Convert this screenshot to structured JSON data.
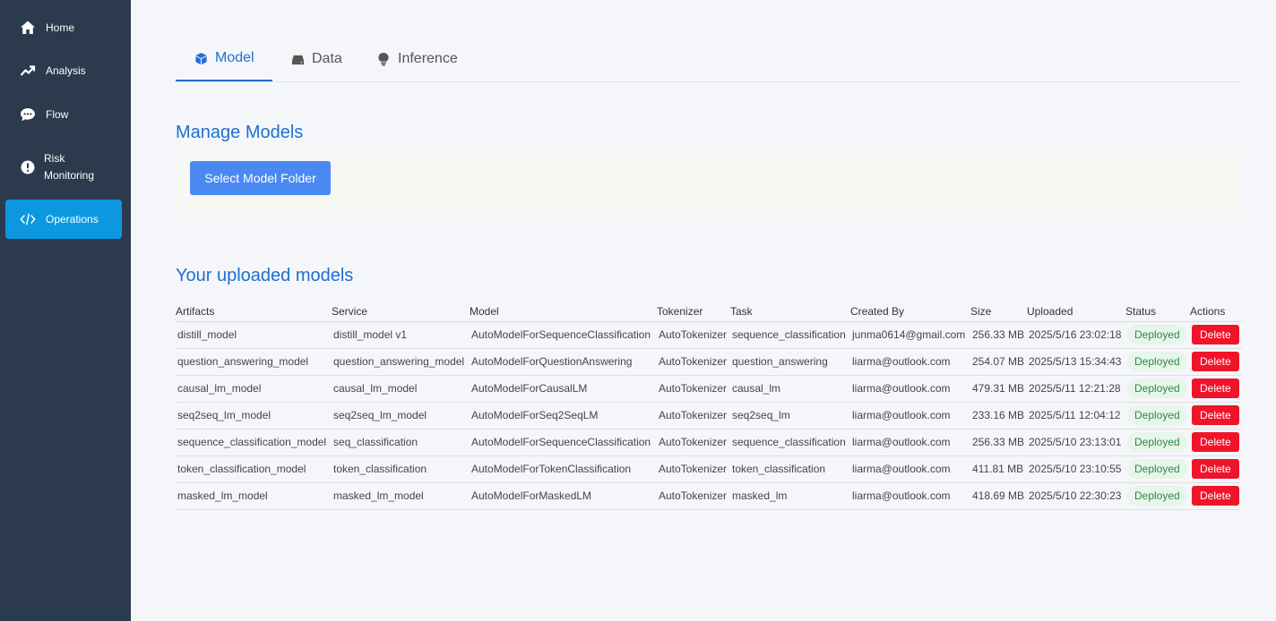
{
  "sidebar": {
    "items": [
      {
        "label": "Home",
        "icon": "home-icon"
      },
      {
        "label": "Analysis",
        "icon": "trending-up-icon"
      },
      {
        "label": "Flow",
        "icon": "chat-icon"
      },
      {
        "label_line1": "Risk",
        "label_line2": "Monitoring",
        "icon": "alert-icon"
      },
      {
        "label": "Operations",
        "icon": "code-icon",
        "active": true
      }
    ]
  },
  "tabs": [
    {
      "label": "Model",
      "icon": "cube-icon",
      "active": true
    },
    {
      "label": "Data",
      "icon": "database-icon"
    },
    {
      "label": "Inference",
      "icon": "lightbulb-icon"
    }
  ],
  "manage": {
    "title": "Manage Models",
    "select_button": "Select Model Folder"
  },
  "uploaded": {
    "title": "Your uploaded models",
    "columns": [
      "Artifacts",
      "Service",
      "Model",
      "Tokenizer",
      "Task",
      "Created By",
      "Size",
      "Uploaded",
      "Status",
      "Actions"
    ],
    "rows": [
      [
        "distill_model",
        "distill_model v1",
        "AutoModelForSequenceClassification",
        "AutoTokenizer",
        "sequence_classification",
        "junma0614@gmail.com",
        "256.33 MB",
        "2025/5/16 23:02:18",
        "Deployed",
        "Delete"
      ],
      [
        "question_answering_model",
        "question_answering_model",
        "AutoModelForQuestionAnswering",
        "AutoTokenizer",
        "question_answering",
        "liarma@outlook.com",
        "254.07 MB",
        "2025/5/13 15:34:43",
        "Deployed",
        "Delete"
      ],
      [
        "causal_lm_model",
        "causal_lm_model",
        "AutoModelForCausalLM",
        "AutoTokenizer",
        "causal_lm",
        "liarma@outlook.com",
        "479.31 MB",
        "2025/5/11 12:21:28",
        "Deployed",
        "Delete"
      ],
      [
        "seq2seq_lm_model",
        "seq2seq_lm_model",
        "AutoModelForSeq2SeqLM",
        "AutoTokenizer",
        "seq2seq_lm",
        "liarma@outlook.com",
        "233.16 MB",
        "2025/5/11 12:04:12",
        "Deployed",
        "Delete"
      ],
      [
        "sequence_classification_model",
        "seq_classification",
        "AutoModelForSequenceClassification",
        "AutoTokenizer",
        "sequence_classification",
        "liarma@outlook.com",
        "256.33 MB",
        "2025/5/10 23:13:01",
        "Deployed",
        "Delete"
      ],
      [
        "token_classification_model",
        "token_classification",
        "AutoModelForTokenClassification",
        "AutoTokenizer",
        "token_classification",
        "liarma@outlook.com",
        "411.81 MB",
        "2025/5/10 23:10:55",
        "Deployed",
        "Delete"
      ],
      [
        "masked_lm_model",
        "masked_lm_model",
        "AutoModelForMaskedLM",
        "AutoTokenizer",
        "masked_lm",
        "liarma@outlook.com",
        "418.69 MB",
        "2025/5/10 22:30:23",
        "Deployed",
        "Delete"
      ]
    ]
  },
  "colors": {
    "sidebar_bg": "#2b3a4d",
    "active_nav": "#0b98e0",
    "accent": "#1f6fd1",
    "primary_button": "#4b89f2",
    "danger": "#f0142a",
    "success_text": "#2d8a45",
    "success_bg": "#e7f5ea"
  }
}
